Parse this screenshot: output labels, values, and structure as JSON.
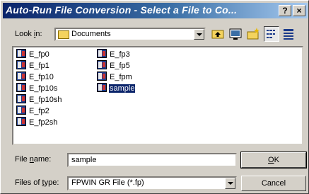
{
  "window": {
    "title": "Auto-Run File Conversion - Select a File to Co...",
    "help_glyph": "?",
    "close_glyph": "×"
  },
  "lookin": {
    "label_pre": "Look ",
    "label_accel": "i",
    "label_post": "n:",
    "value": "Documents"
  },
  "toolbar": [
    "up-folder",
    "desktop",
    "new-folder",
    "list-view",
    "details-view"
  ],
  "files": [
    {
      "name": "E_fp0"
    },
    {
      "name": "E_fp1"
    },
    {
      "name": "E_fp10"
    },
    {
      "name": "E_fp10s"
    },
    {
      "name": "E_fp10sh"
    },
    {
      "name": "E_fp2"
    },
    {
      "name": "E_fp2sh"
    },
    {
      "name": "E_fp3"
    },
    {
      "name": "E_fp5"
    },
    {
      "name": "E_fpm"
    },
    {
      "name": "sample",
      "selected": true
    }
  ],
  "filename": {
    "label_pre": "File ",
    "label_accel": "n",
    "label_post": "ame:",
    "value": "sample"
  },
  "filetype": {
    "label_pre": "Files of ",
    "label_accel": "t",
    "label_post": "ype:",
    "value": "FPWIN GR File (*.fp)"
  },
  "buttons": {
    "ok_accel": "O",
    "ok_rest": "K",
    "cancel": "Cancel"
  }
}
